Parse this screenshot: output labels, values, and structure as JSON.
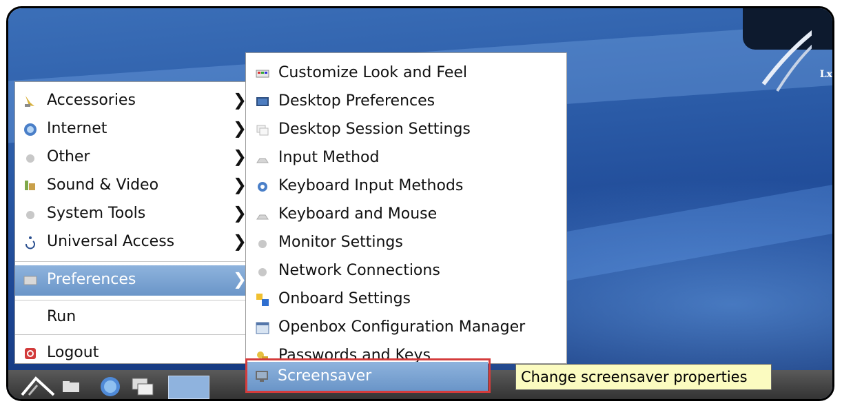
{
  "desktop": {
    "logo_text": "Lx"
  },
  "main_menu": {
    "items": [
      {
        "label": "Accessories",
        "icon": "accessories-icon",
        "has_submenu": true
      },
      {
        "label": "Internet",
        "icon": "internet-icon",
        "has_submenu": true
      },
      {
        "label": "Other",
        "icon": "other-icon",
        "has_submenu": true
      },
      {
        "label": "Sound & Video",
        "icon": "sound-video-icon",
        "has_submenu": true
      },
      {
        "label": "System Tools",
        "icon": "system-tools-icon",
        "has_submenu": true
      },
      {
        "label": "Universal Access",
        "icon": "universal-access-icon",
        "has_submenu": true
      },
      {
        "label": "Preferences",
        "icon": "preferences-icon",
        "has_submenu": true,
        "selected": true
      },
      {
        "label": "Run",
        "has_submenu": false
      },
      {
        "label": "Logout",
        "icon": "logout-icon",
        "has_submenu": false
      }
    ],
    "arrow": "❯"
  },
  "preferences_menu": {
    "items": [
      {
        "label": "Customize Look and Feel",
        "icon": "appearance-icon"
      },
      {
        "label": "Desktop Preferences",
        "icon": "desktop-icon"
      },
      {
        "label": "Desktop Session Settings",
        "icon": "session-icon"
      },
      {
        "label": "Input Method",
        "icon": "input-method-icon"
      },
      {
        "label": "Keyboard Input Methods",
        "icon": "keyboard-gear-icon"
      },
      {
        "label": "Keyboard and Mouse",
        "icon": "keyboard-icon"
      },
      {
        "label": "Monitor Settings",
        "icon": "monitor-icon"
      },
      {
        "label": "Network Connections",
        "icon": "network-icon"
      },
      {
        "label": "Onboard Settings",
        "icon": "onboard-icon"
      },
      {
        "label": "Openbox Configuration Manager",
        "icon": "openbox-icon"
      },
      {
        "label": "Passwords and Keys",
        "icon": "keys-icon"
      },
      {
        "label": "Screensaver",
        "icon": "screensaver-icon",
        "selected": true
      }
    ]
  },
  "tooltip": {
    "text": "Change screensaver properties"
  },
  "colors": {
    "selection": "#7aa3d3",
    "highlight_box": "#d43c3c",
    "tooltip_bg": "#fbfbc0"
  }
}
